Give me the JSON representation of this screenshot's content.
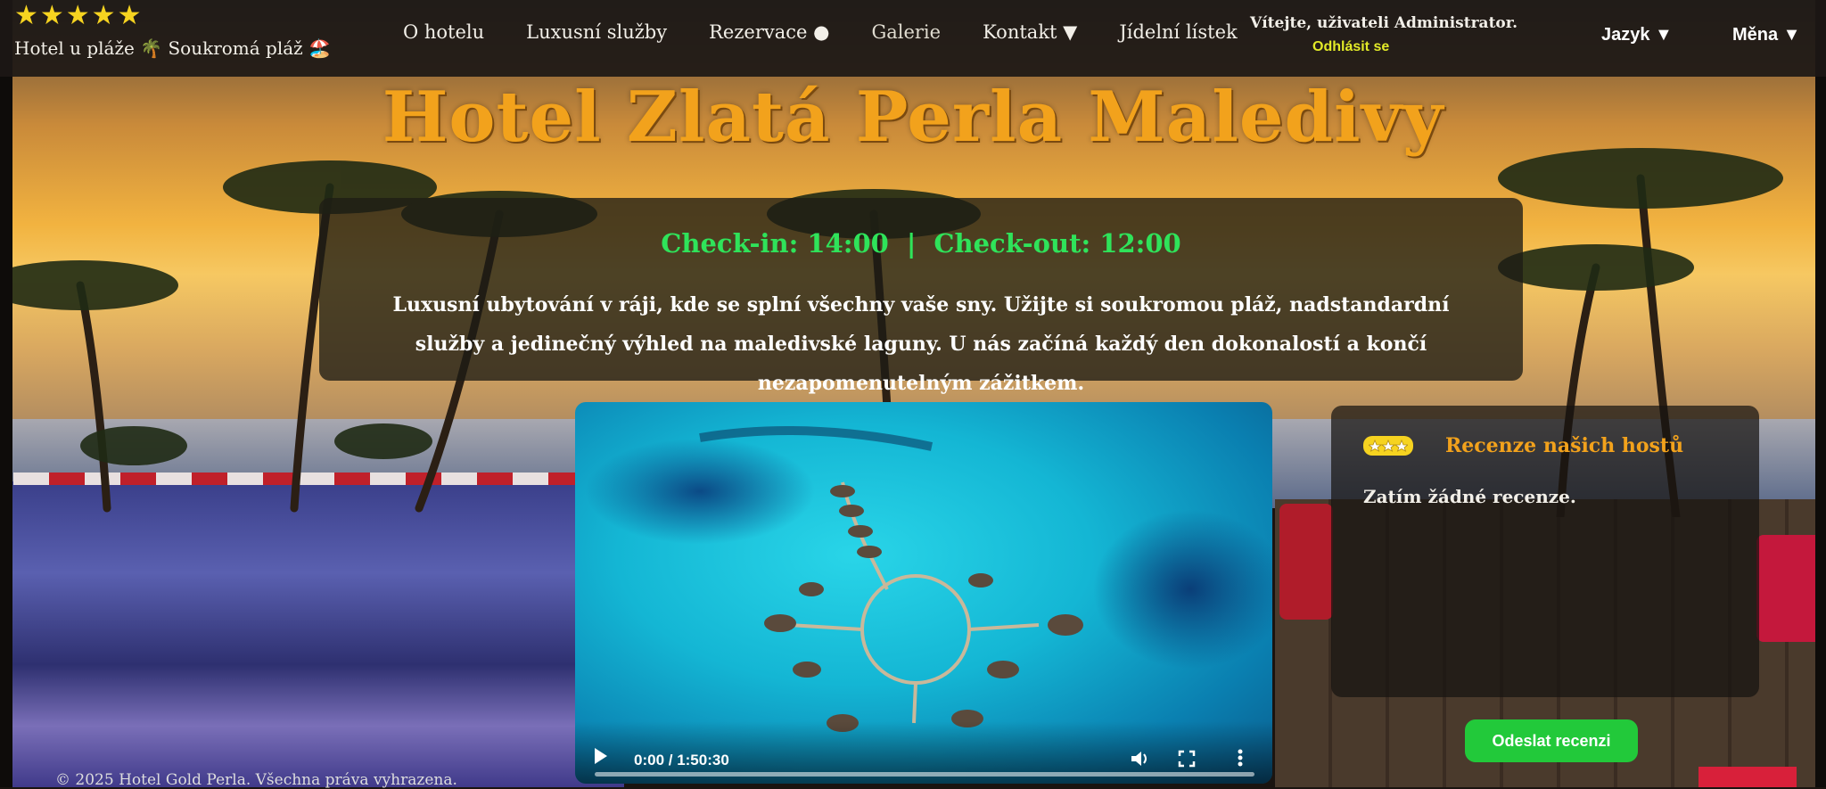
{
  "header": {
    "stars": "★★★★★",
    "tagline": "Hotel u pláže 🌴 Soukromá pláž 🏖️"
  },
  "nav": {
    "items": [
      "O hotelu",
      "Luxusní služby",
      "Rezervace ●",
      "Galerie",
      "Kontakt ▼",
      "Jídelní lístek"
    ]
  },
  "user": {
    "welcome": "Vítejte, uživateli Administrator.",
    "logout": "Odhlásit se"
  },
  "selectors": {
    "language": "Jazyk ▼",
    "currency": "Měna ▼"
  },
  "hero": {
    "title": "Hotel Zlatá Perla Maledivy",
    "checkin": "Check-in: 14:00",
    "separator": "|",
    "checkout": "Check-out: 12:00",
    "description": "Luxusní ubytování v ráji, kde se splní všechny vaše sny. Užijte si soukromou pláž, nadstandardní služby a jedinečný výhled na maledivské laguny. U nás začíná každý den dokonalostí a končí nezapomenutelným zážitkem."
  },
  "video": {
    "time": "0:00 / 1:50:30",
    "progress": 0
  },
  "reviews": {
    "title": "Recenze našich hostů",
    "empty": "Zatím žádné recenze.",
    "send": "Odeslat recenzi"
  },
  "footer": {
    "copyright": "© 2025 Hotel Gold Perla. Všechna práva vyhrazena."
  },
  "colors": {
    "accent_gold": "#f2a21c",
    "checktime_green": "#2fe35a",
    "button_green": "#22c93a",
    "logout_yellow": "#e2ea28"
  }
}
